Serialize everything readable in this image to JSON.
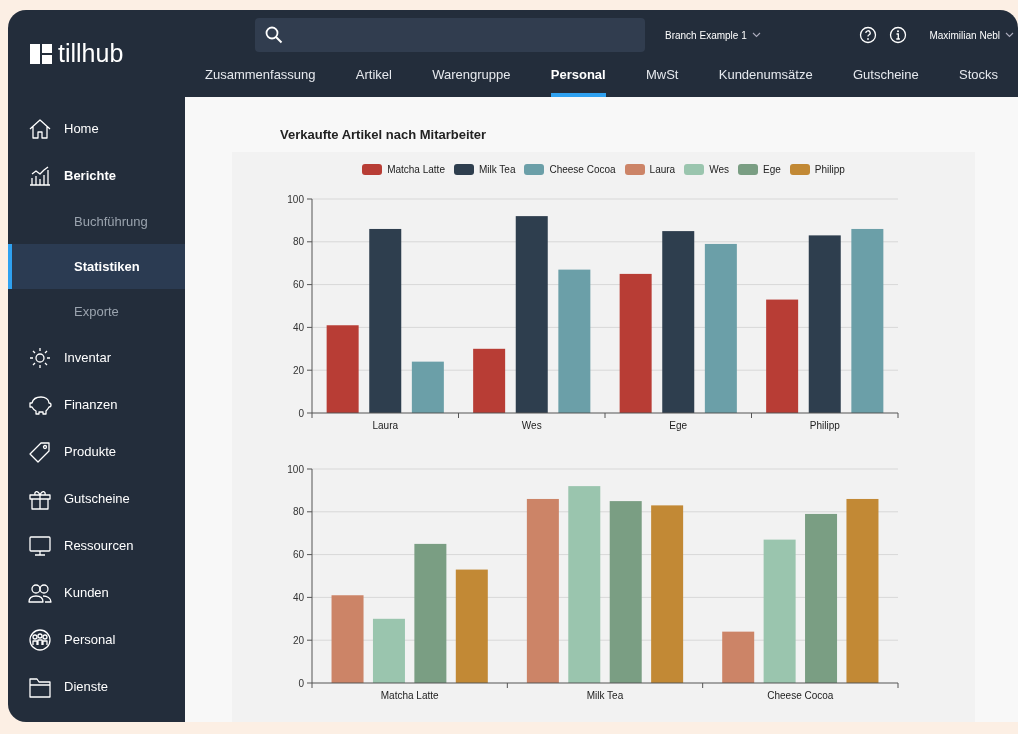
{
  "brand": {
    "name": "tillhub"
  },
  "topbar": {
    "branch": "Branch Example 1",
    "user": "Maximilian Nebl"
  },
  "tabs": [
    {
      "label": "Zusammenfassung",
      "selected": false
    },
    {
      "label": "Artikel",
      "selected": false
    },
    {
      "label": "Warengruppe",
      "selected": false
    },
    {
      "label": "Personal",
      "selected": true
    },
    {
      "label": "MwSt",
      "selected": false
    },
    {
      "label": "Kundenumsätze",
      "selected": false
    },
    {
      "label": "Gutscheine",
      "selected": false
    },
    {
      "label": "Stocks",
      "selected": false
    }
  ],
  "sidebar": {
    "items": [
      {
        "label": "Home",
        "kind": "home",
        "selected": false
      },
      {
        "label": "Berichte",
        "kind": "chart",
        "selected": false,
        "expanded": true,
        "children": [
          {
            "label": "Buchführung",
            "selected": false
          },
          {
            "label": "Statistiken",
            "selected": true
          },
          {
            "label": "Exporte",
            "selected": false
          }
        ]
      },
      {
        "label": "Inventar",
        "kind": "sun",
        "selected": false
      },
      {
        "label": "Finanzen",
        "kind": "piggy",
        "selected": false
      },
      {
        "label": "Produkte",
        "kind": "tag",
        "selected": false
      },
      {
        "label": "Gutscheine",
        "kind": "gift",
        "selected": false
      },
      {
        "label": "Ressourcen",
        "kind": "monitor",
        "selected": false
      },
      {
        "label": "Kunden",
        "kind": "users",
        "selected": false
      },
      {
        "label": "Personal",
        "kind": "team",
        "selected": false
      },
      {
        "label": "Dienste",
        "kind": "folder",
        "selected": false
      }
    ]
  },
  "content": {
    "title": "Verkaufte Artikel nach Mitarbeiter",
    "charts": [
      {
        "chart_data": {
          "type": "bar",
          "grid": true,
          "categories": [
            "Laura",
            "Wes",
            "Ege",
            "Philipp"
          ],
          "ylim": [
            0,
            100
          ],
          "yticks": [
            0,
            20,
            40,
            60,
            80,
            100
          ],
          "series": [
            {
              "name": "Matcha Latte",
              "color": "#b83d35",
              "values": [
                41,
                30,
                65,
                53
              ]
            },
            {
              "name": "Milk Tea",
              "color": "#2e3e4e",
              "values": [
                86,
                92,
                85,
                83
              ]
            },
            {
              "name": "Cheese Cocoa",
              "color": "#6b9fa8",
              "values": [
                24,
                67,
                79,
                86
              ]
            }
          ]
        }
      },
      {
        "chart_data": {
          "type": "bar",
          "grid": true,
          "categories": [
            "Matcha Latte",
            "Milk Tea",
            "Cheese Cocoa"
          ],
          "ylim": [
            0,
            100
          ],
          "yticks": [
            0,
            20,
            40,
            60,
            80,
            100
          ],
          "series": [
            {
              "name": "Laura",
              "color": "#cc8467",
              "values": [
                41,
                86,
                24
              ]
            },
            {
              "name": "Wes",
              "color": "#9ac5ae",
              "values": [
                30,
                92,
                67
              ]
            },
            {
              "name": "Ege",
              "color": "#7a9e83",
              "values": [
                65,
                85,
                79
              ]
            },
            {
              "name": "Philipp",
              "color": "#c28935",
              "values": [
                53,
                83,
                86
              ]
            }
          ]
        }
      }
    ]
  }
}
